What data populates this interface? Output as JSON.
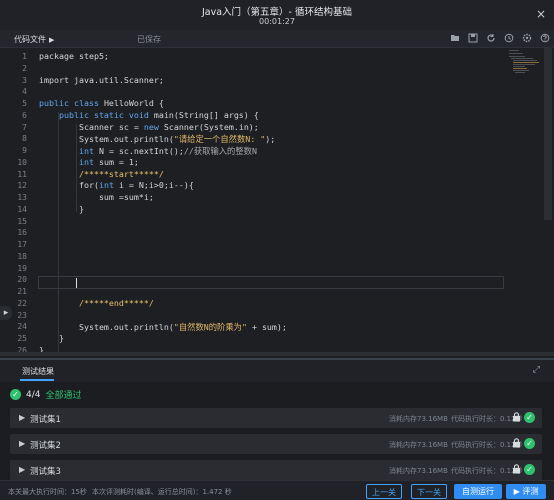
{
  "titlebar": {
    "title": "Java入门（第五章）- 循环结构基础",
    "time": "00:01:27",
    "close_icon": "×"
  },
  "toolbar": {
    "tab_label": "代码文件",
    "tab_arrow": "▶",
    "saved": "已保存",
    "icons": [
      "folder-icon",
      "save-icon",
      "refresh-icon",
      "history-icon",
      "settings-icon",
      "help-icon"
    ]
  },
  "editor": {
    "line_numbers": [
      "1",
      "2",
      "3",
      "4",
      "5",
      "6",
      "7",
      "8",
      "9",
      "10",
      "11",
      "12",
      "13",
      "14",
      "15",
      "16",
      "17",
      "18",
      "19",
      "20",
      "21",
      "22",
      "23",
      "24",
      "25",
      "26"
    ],
    "lines": [
      {
        "n": 0,
        "tokens": [
          {
            "t": "package step5;",
            "c": ""
          }
        ]
      },
      {
        "n": 2,
        "tokens": [
          {
            "t": "import java.util.Scanner;",
            "c": ""
          }
        ]
      },
      {
        "n": 4,
        "tokens": [
          {
            "t": "public class ",
            "c": "kw"
          },
          {
            "t": "HelloWorld {",
            "c": ""
          }
        ]
      },
      {
        "n": 5,
        "tokens": [
          {
            "t": "    public static void ",
            "c": "kw"
          },
          {
            "t": "main(String[] args) {",
            "c": ""
          }
        ]
      },
      {
        "n": 6,
        "tokens": [
          {
            "t": "        Scanner sc = ",
            "c": ""
          },
          {
            "t": "new ",
            "c": "kw"
          },
          {
            "t": "Scanner(System.in);",
            "c": ""
          }
        ]
      },
      {
        "n": 7,
        "tokens": [
          {
            "t": "        System.out.println(",
            "c": ""
          },
          {
            "t": "\"请给定一个自然数N: \"",
            "c": "str"
          },
          {
            "t": ");",
            "c": ""
          }
        ]
      },
      {
        "n": 8,
        "tokens": [
          {
            "t": "        int ",
            "c": "kw"
          },
          {
            "t": "N = sc.nextInt();",
            "c": ""
          },
          {
            "t": "//获取输入的整数N",
            "c": "cmt"
          }
        ]
      },
      {
        "n": 9,
        "tokens": [
          {
            "t": "        int ",
            "c": "kw"
          },
          {
            "t": "sum = 1;",
            "c": ""
          }
        ]
      },
      {
        "n": 10,
        "tokens": [
          {
            "t": "        /*****start*****/",
            "c": "cm"
          }
        ]
      },
      {
        "n": 11,
        "tokens": [
          {
            "t": "        for(",
            "c": ""
          },
          {
            "t": "int ",
            "c": "kw"
          },
          {
            "t": "i = N;i>0;i--){",
            "c": ""
          }
        ]
      },
      {
        "n": 12,
        "tokens": [
          {
            "t": "            sum =sum*i;",
            "c": ""
          }
        ]
      },
      {
        "n": 13,
        "tokens": [
          {
            "t": "        }",
            "c": ""
          }
        ]
      },
      {
        "n": 21,
        "tokens": [
          {
            "t": "        /*****end*****/",
            "c": "cm"
          }
        ]
      },
      {
        "n": 23,
        "tokens": [
          {
            "t": "        System.out.println(",
            "c": ""
          },
          {
            "t": "\"自然数N的阶乘为\"",
            "c": "str"
          },
          {
            "t": " + sum);",
            "c": ""
          }
        ]
      },
      {
        "n": 24,
        "tokens": [
          {
            "t": "    }",
            "c": ""
          }
        ]
      },
      {
        "n": 25,
        "tokens": [
          {
            "t": "}",
            "c": ""
          }
        ]
      }
    ]
  },
  "results": {
    "tab_label": "测试结果",
    "expand_icon": "⤢",
    "count": "4/4",
    "pass_label": "全部通过",
    "cases": [
      {
        "name": "测试集1",
        "memory": "消耗内存73.16MB",
        "duration": "代码执行时长：0.12秒"
      },
      {
        "name": "测试集2",
        "memory": "消耗内存73.16MB",
        "duration": "代码执行时长：0.12秒"
      },
      {
        "name": "测试集3",
        "memory": "消耗内存73.16MB",
        "duration": "代码执行时长：0.12秒"
      }
    ]
  },
  "footer": {
    "max_exec": "本关最大执行时间：15秒",
    "eval_time": "本次评测耗时(编译、运行总时间)：1.472 秒",
    "prev_label": "上一关",
    "next_label": "下一关",
    "custom_test_label": "自测运行",
    "evaluate_label": "评测"
  },
  "colors": {
    "accent": "#2f8cf0",
    "success": "#2ec26f",
    "keyword": "#5fa8f0",
    "string": "#e0b86b"
  }
}
